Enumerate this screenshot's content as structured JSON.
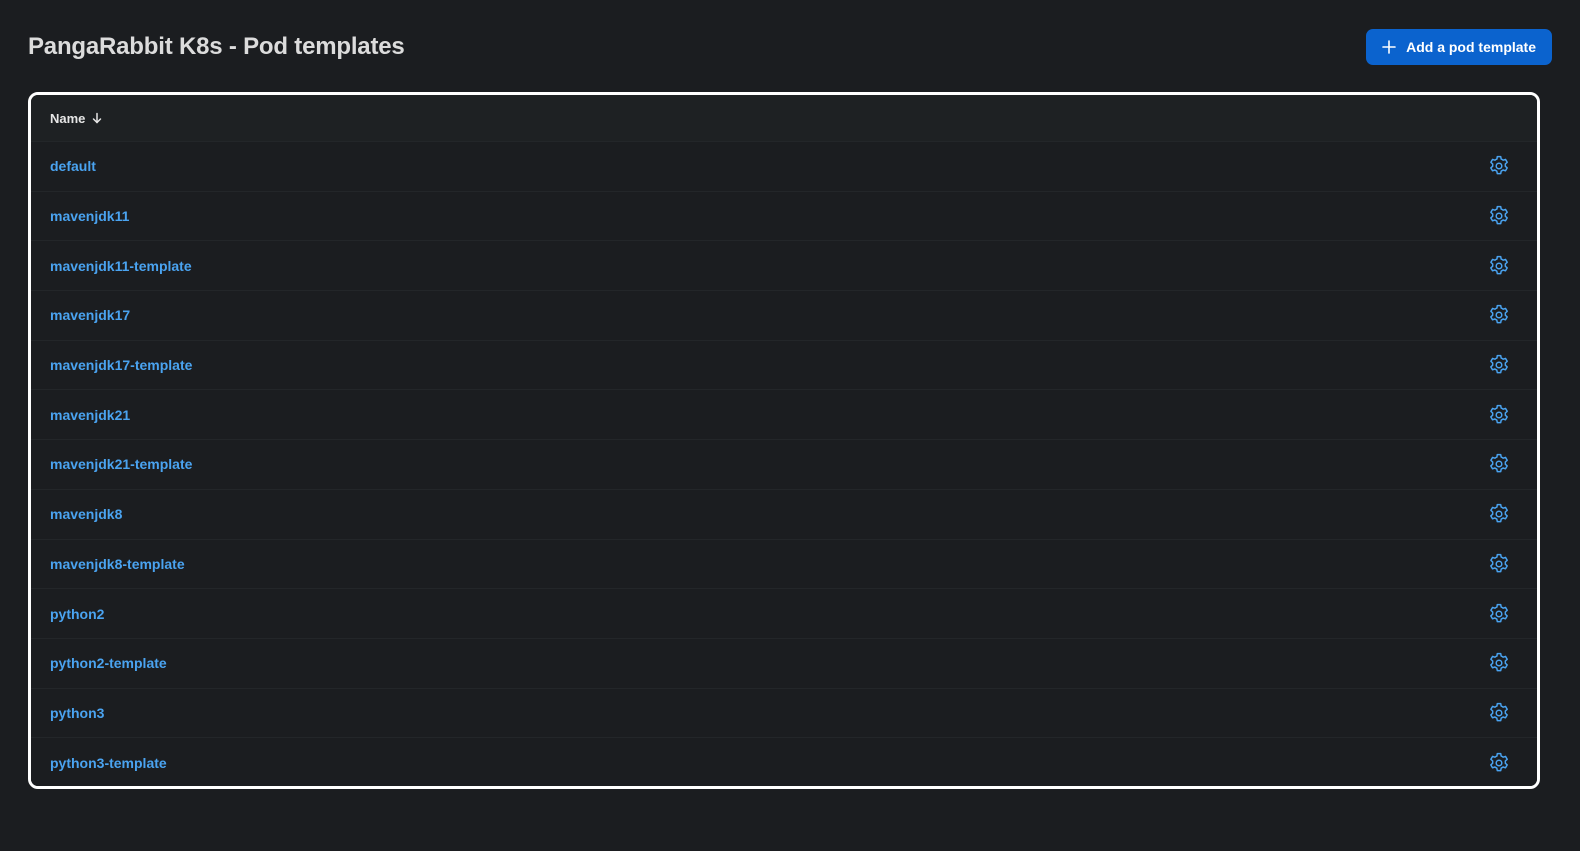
{
  "header": {
    "title": "PangaRabbit K8s - Pod templates",
    "add_button_label": "Add a pod template",
    "add_button_icon": "plus-icon"
  },
  "table": {
    "columns": [
      {
        "label": "Name",
        "sort": "descending",
        "sort_icon": "arrow-down-icon"
      }
    ],
    "row_action_icon": "gear-icon",
    "rows": [
      {
        "name": "default"
      },
      {
        "name": "mavenjdk11"
      },
      {
        "name": "mavenjdk11-template"
      },
      {
        "name": "mavenjdk17"
      },
      {
        "name": "mavenjdk17-template"
      },
      {
        "name": "mavenjdk21"
      },
      {
        "name": "mavenjdk21-template"
      },
      {
        "name": "mavenjdk8"
      },
      {
        "name": "mavenjdk8-template"
      },
      {
        "name": "python2"
      },
      {
        "name": "python2-template"
      },
      {
        "name": "python3"
      },
      {
        "name": "python3-template"
      }
    ]
  },
  "colors": {
    "background": "#1b1d20",
    "accent": "#0b63ce",
    "link": "#4aa3f0",
    "table_border": "#ffffff"
  }
}
